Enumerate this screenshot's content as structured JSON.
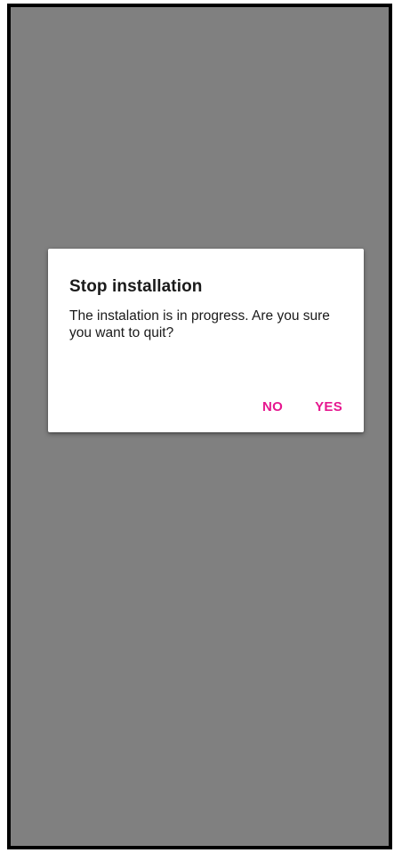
{
  "dialog": {
    "title": "Stop installation",
    "message": "The instalation is in progress. Are you sure you want to quit?",
    "negative_label": "NO",
    "positive_label": "YES"
  },
  "colors": {
    "scrim": "#808080",
    "accent": "#e6178f",
    "dialog_background": "#ffffff",
    "frame": "#000000"
  }
}
